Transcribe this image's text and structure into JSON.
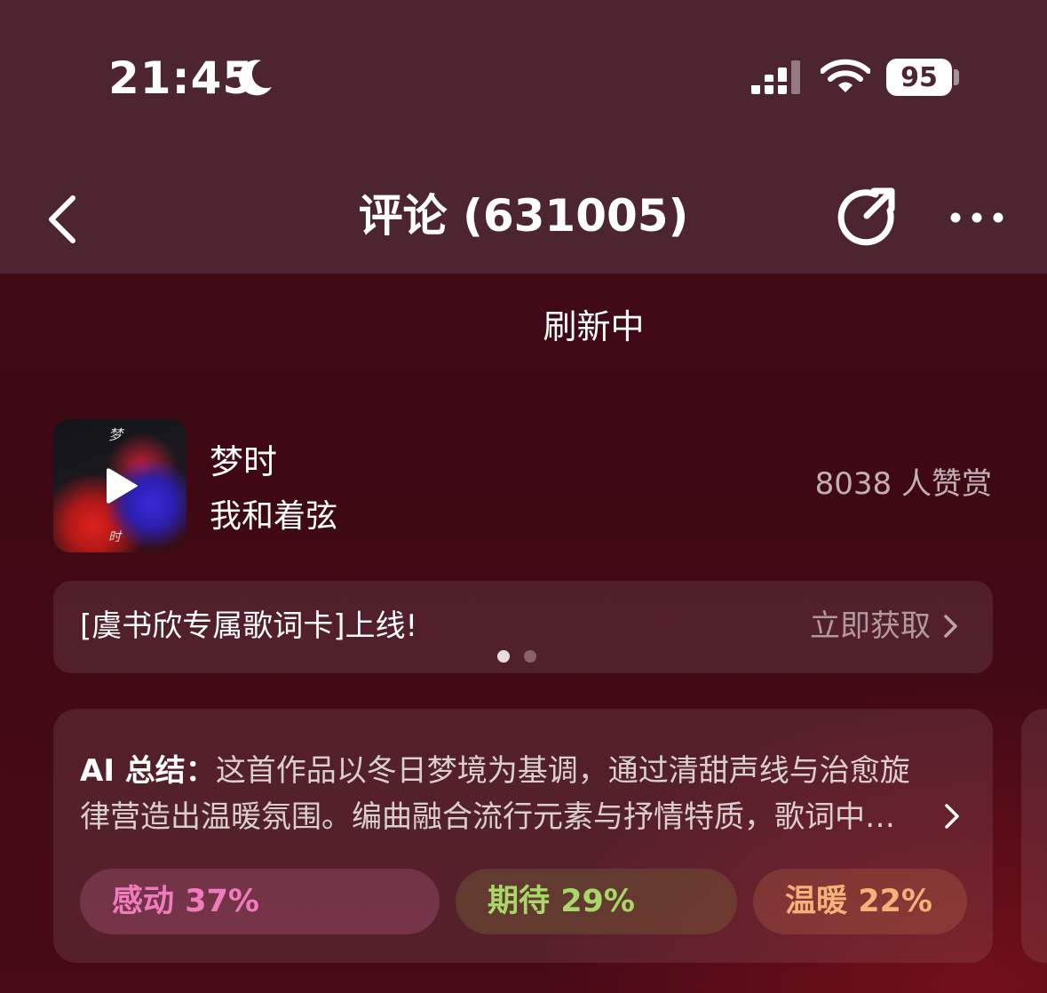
{
  "status_bar": {
    "time": "21:45",
    "battery": "95",
    "icons": [
      "moon-icon",
      "signal-icon",
      "wifi-icon",
      "battery-icon"
    ]
  },
  "nav": {
    "title": "评论 (631005)",
    "icons": [
      "back-icon",
      "share-icon",
      "more-icon"
    ]
  },
  "refresh_text": "刷新中",
  "song": {
    "title": "梦时",
    "artist": "我和着弦",
    "likes": "8038 人赞赏",
    "cover_text_top": "梦",
    "cover_text_bottom": "时"
  },
  "banner": {
    "text": "[虞书欣专属歌词卡]上线!",
    "action": "立即获取",
    "active_slide": 1,
    "slide_count": 2
  },
  "ai_summary": {
    "label": "AI 总结：",
    "line1": "这首作品以冬日梦境为基调，通过清甜声线与治愈旋",
    "line2": "律营造出温暖氛围。编曲融合流行元素与抒情特质，歌词中…",
    "tags": [
      {
        "label": "感动",
        "percent": "37%"
      },
      {
        "label": "期待",
        "percent": "29%"
      },
      {
        "label": "温暖",
        "percent": "22%"
      }
    ]
  },
  "colors": {
    "header_bg": "#4d2530",
    "page_bg": "#3d0914",
    "tag_pink": "#f27bbf",
    "tag_green": "#a8d868",
    "tag_orange": "#f6b07a"
  }
}
